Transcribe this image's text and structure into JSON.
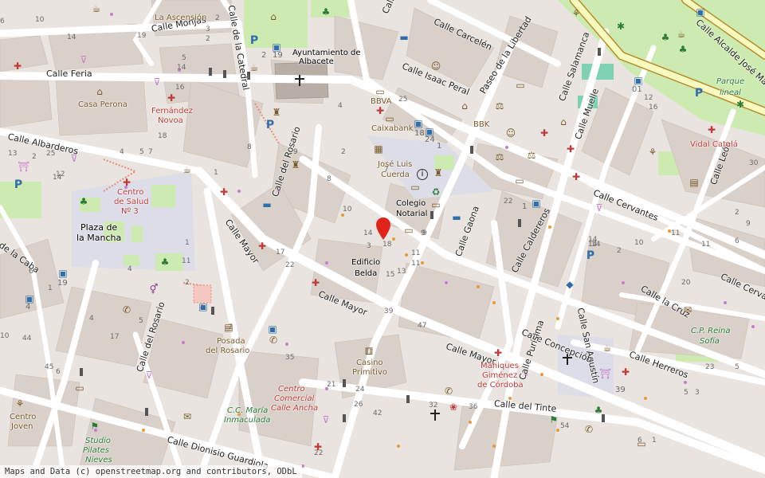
{
  "attribution": "Maps and Data (c) openstreetmap.org and contributors, ODbL",
  "colors": {
    "land": "#e9e4df",
    "building": "#d9d0c9",
    "road": "#ffffff",
    "pedestrian": "#dddde8",
    "park": "#cdebb0",
    "water": "#aad3df",
    "poi_red": "#c03a3a",
    "poi_green": "#2c7b37",
    "marker": "#e0231b"
  },
  "streets": [
    {
      "id": "monjas",
      "text": "Calle Monjas"
    },
    {
      "id": "catedral",
      "text": "Calle de la Catedral"
    },
    {
      "id": "carcelen",
      "text": "Calle Carcelén"
    },
    {
      "id": "alcalde",
      "text": "Calle Alcalde José María"
    },
    {
      "id": "feria",
      "text": "Calle Feria"
    },
    {
      "id": "isaac",
      "text": "Calle Isaac Peral"
    },
    {
      "id": "libertad",
      "text": "Paseo de la Libertad"
    },
    {
      "id": "salamanca",
      "text": "Calle Salamanca"
    },
    {
      "id": "albarderos",
      "text": "Calle Albarderos"
    },
    {
      "id": "muelle",
      "text": "Calle Muelle"
    },
    {
      "id": "leon",
      "text": "Calle León"
    },
    {
      "id": "cervantes",
      "text": "Calle Cervantes"
    },
    {
      "id": "rosario1",
      "text": "Calle del Rosario"
    },
    {
      "id": "mayor1",
      "text": "Calle Mayor"
    },
    {
      "id": "gaona",
      "text": "Calle Gaona"
    },
    {
      "id": "caldereros",
      "text": "Calle Caldereros"
    },
    {
      "id": "caba",
      "text": "de la Caba"
    },
    {
      "id": "sanagustin",
      "text": "Calle San Agustín"
    },
    {
      "id": "lacruz",
      "text": "Calle la Cruz"
    },
    {
      "id": "cerv2",
      "text": "Calle Cerva"
    },
    {
      "id": "mayor2",
      "text": "Calle Mayor"
    },
    {
      "id": "concepcion",
      "text": "Calle Concepción"
    },
    {
      "id": "mayor3",
      "text": "Calle Mayor"
    },
    {
      "id": "herreros",
      "text": "Calle Herreros"
    },
    {
      "id": "purisima",
      "text": "Calle Purísima"
    },
    {
      "id": "rosario2",
      "text": "Calle del Rosario"
    },
    {
      "id": "tinte",
      "text": "Calle del Tinte"
    },
    {
      "id": "dionisio",
      "text": "Calle Dionisio Guardiola"
    },
    {
      "id": "calleS",
      "text": "Calle S"
    }
  ],
  "places": [
    {
      "id": "ascension",
      "text": "La Ascensión",
      "cls": "brown"
    },
    {
      "id": "ayto1",
      "text": "Ayuntamiento de",
      "cls": ""
    },
    {
      "id": "ayto2",
      "text": "Albacete",
      "cls": ""
    },
    {
      "id": "perona",
      "text": "Casa Perona",
      "cls": "brown"
    },
    {
      "id": "novoa1",
      "text": "Fernández",
      "cls": "red"
    },
    {
      "id": "novoa2",
      "text": "Novoa",
      "cls": "red"
    },
    {
      "id": "bbva",
      "text": "BBVA",
      "cls": "brown"
    },
    {
      "id": "caixa",
      "text": "Caixabank",
      "cls": "brown"
    },
    {
      "id": "bbk",
      "text": "BBK",
      "cls": "brown"
    },
    {
      "id": "parque1",
      "text": "Parque",
      "cls": "green"
    },
    {
      "id": "parque2",
      "text": "lineal",
      "cls": "green"
    },
    {
      "id": "vidal",
      "text": "Vidal Catalá",
      "cls": "red"
    },
    {
      "id": "cuerda1",
      "text": "José Luis",
      "cls": "brown"
    },
    {
      "id": "cuerda2",
      "text": "Cuerda",
      "cls": "brown"
    },
    {
      "id": "colegio1",
      "text": "Colegio",
      "cls": ""
    },
    {
      "id": "colegio2",
      "text": "Notarial",
      "cls": ""
    },
    {
      "id": "salud1",
      "text": "Centro",
      "cls": "red"
    },
    {
      "id": "salud2",
      "text": "de Salud",
      "cls": "red"
    },
    {
      "id": "salud3",
      "text": "Nº 3",
      "cls": "red"
    },
    {
      "id": "mancha1",
      "text": "Plaza de",
      "cls": ""
    },
    {
      "id": "mancha2",
      "text": "la Mancha",
      "cls": ""
    },
    {
      "id": "belda1",
      "text": "Edificio",
      "cls": ""
    },
    {
      "id": "belda2",
      "text": "Belda",
      "cls": ""
    },
    {
      "id": "posada1",
      "text": "Posada",
      "cls": "brown"
    },
    {
      "id": "posada2",
      "text": "del Rosario",
      "cls": "brown"
    },
    {
      "id": "casino1",
      "text": "Casino",
      "cls": "brown"
    },
    {
      "id": "casino2",
      "text": "Primitivo",
      "cls": "brown"
    },
    {
      "id": "mahq1",
      "text": "Mahiques",
      "cls": "red"
    },
    {
      "id": "mahq2",
      "text": "Giménez",
      "cls": "red"
    },
    {
      "id": "mahq3",
      "text": "de Córdoba",
      "cls": "red"
    },
    {
      "id": "reina1",
      "text": "C.P. Reina",
      "cls": "green"
    },
    {
      "id": "reina2",
      "text": "Sofía",
      "cls": "green"
    },
    {
      "id": "cc1",
      "text": "Centro",
      "cls": "red"
    },
    {
      "id": "cc2",
      "text": "Comercial",
      "cls": "red"
    },
    {
      "id": "cc3",
      "text": "Calle Ancha",
      "cls": "red"
    },
    {
      "id": "ccm1",
      "text": "C.C. María",
      "cls": "green"
    },
    {
      "id": "ccm2",
      "text": "Inmaculada",
      "cls": "green"
    },
    {
      "id": "joven1",
      "text": "Centro",
      "cls": "brown"
    },
    {
      "id": "joven2",
      "text": "Joven",
      "cls": "brown"
    },
    {
      "id": "studio1",
      "text": "Studio",
      "cls": "green"
    },
    {
      "id": "studio2",
      "text": "Pilates",
      "cls": "green"
    },
    {
      "id": "studio3",
      "text": "Nieves",
      "cls": "green"
    }
  ],
  "house_numbers": [
    "6",
    "10",
    "14",
    "19",
    "3",
    "2",
    "5",
    "14",
    "2",
    "8",
    "16",
    "18",
    "14",
    "3",
    "9",
    "11",
    "18",
    "25",
    "13",
    "2",
    "4",
    "5",
    "7",
    "1",
    "9",
    "14",
    "10",
    "8",
    "4",
    "2",
    "17",
    "12",
    "22",
    "25",
    "7",
    "5",
    "4",
    "1",
    "17",
    "6",
    "6",
    "14",
    "22",
    "9",
    "11",
    "13",
    "15",
    "39",
    "47",
    "10",
    "2",
    "20",
    "12",
    "16",
    "23",
    "5",
    "11",
    "11",
    "2",
    "9",
    "6",
    "30",
    "14",
    "44",
    "45",
    "10",
    "21",
    "24",
    "36",
    "54",
    "32",
    "42",
    "22",
    "26",
    "35",
    "7",
    "2",
    "11",
    "4",
    "1",
    "14",
    "5",
    "3",
    "1",
    "6"
  ],
  "bus_numbers": [
    "2",
    "19",
    "18",
    "24",
    "1",
    "1",
    "01",
    "19",
    "4",
    "39"
  ],
  "marker": {
    "label": "location-marker"
  }
}
